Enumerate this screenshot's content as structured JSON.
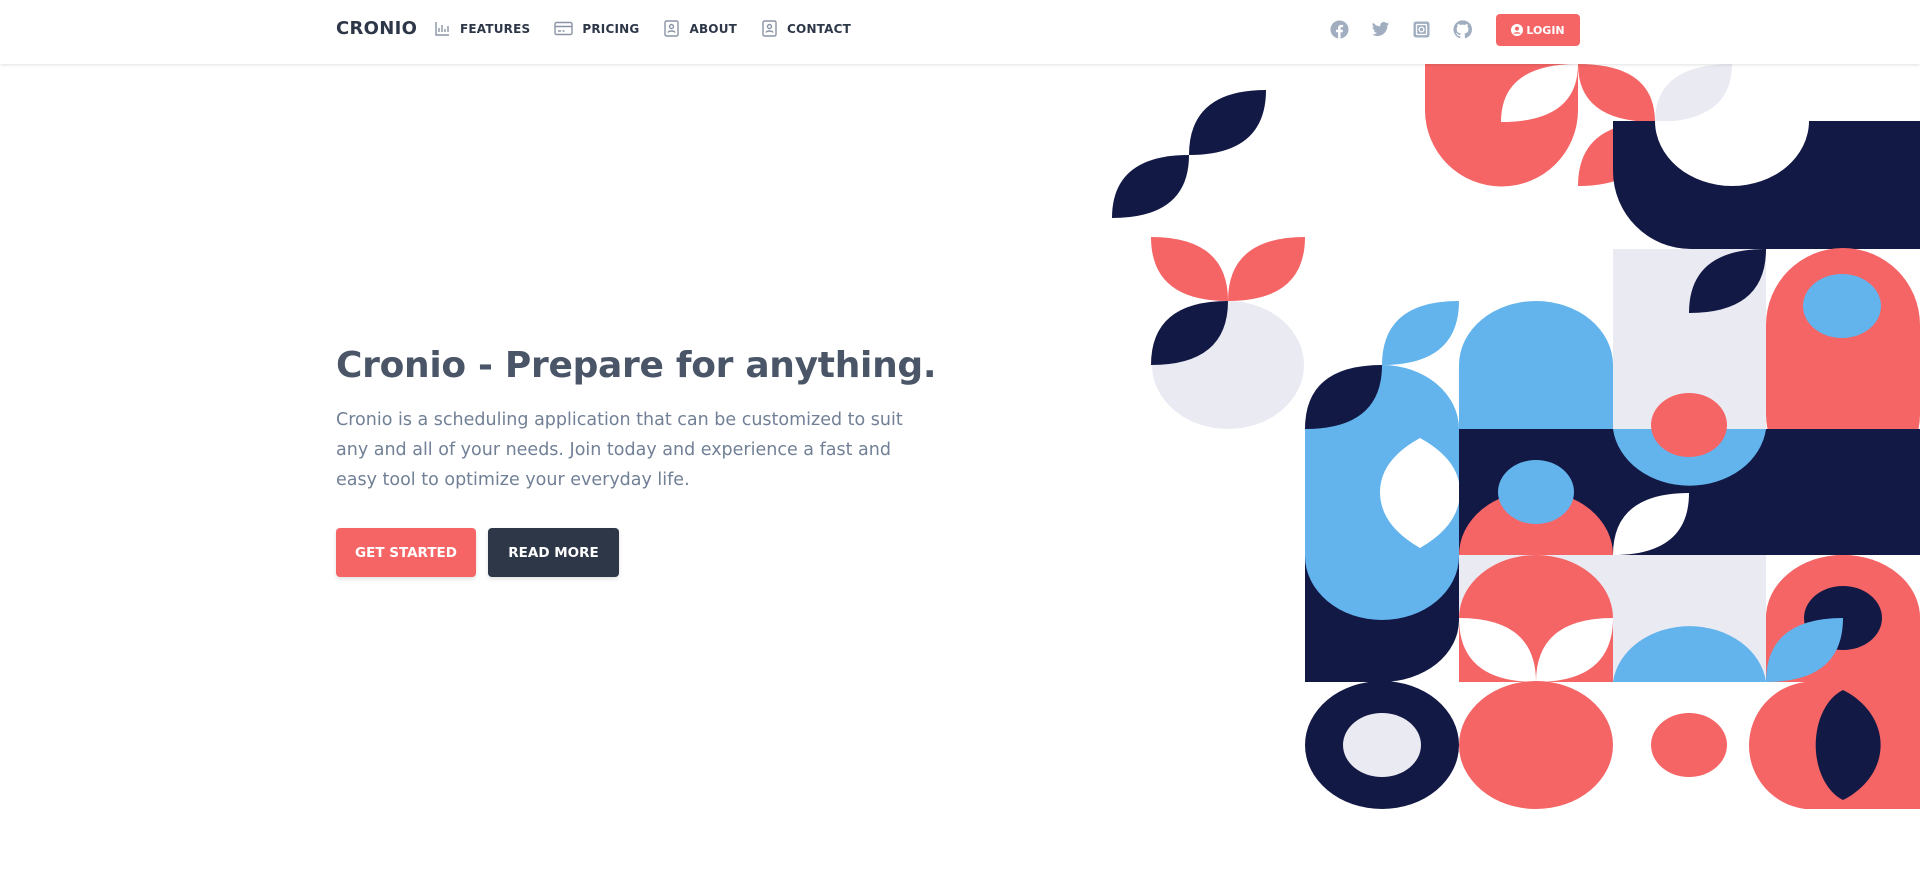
{
  "nav": {
    "brand": "CRONIO",
    "links": [
      {
        "label": "FEATURES",
        "icon": "bar-chart-icon"
      },
      {
        "label": "PRICING",
        "icon": "credit-card-icon"
      },
      {
        "label": "ABOUT",
        "icon": "contact-card-icon"
      },
      {
        "label": "CONTACT",
        "icon": "contact-card-icon"
      }
    ],
    "social": [
      "facebook-icon",
      "twitter-icon",
      "instagram-icon",
      "github-icon"
    ],
    "login_label": "LOGIN",
    "login_icon": "user-circle-icon"
  },
  "hero": {
    "title": "Cronio - Prepare for anything.",
    "description": "Cronio is a scheduling application that can be customized to suit any and all of your needs. Join today and experience a fast and easy tool to optimize your everyday life.",
    "primary_button": "GET STARTED",
    "secondary_button": "READ MORE"
  },
  "colors": {
    "accent": "#f56565",
    "dark": "#2d3748",
    "navy": "#131945",
    "sky": "#63b3ed",
    "light": "#eaeaf3"
  }
}
